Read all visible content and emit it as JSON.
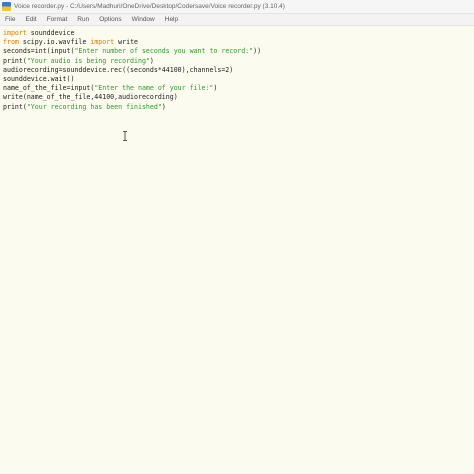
{
  "window": {
    "title": "Voice recorder.py - C:/Users/Madhuri/OneDrive/Desktop/Codersave/Voice recorder.py (3.10.4)",
    "icon": "python-file-icon"
  },
  "menu": {
    "items": [
      "File",
      "Edit",
      "Format",
      "Run",
      "Options",
      "Window",
      "Help"
    ]
  },
  "editor": {
    "lines": [
      [
        {
          "t": "kw",
          "v": "import"
        },
        {
          "t": "plain",
          "v": " sounddevice"
        }
      ],
      [
        {
          "t": "kw",
          "v": "from"
        },
        {
          "t": "plain",
          "v": " scipy.io.wavfile "
        },
        {
          "t": "kw",
          "v": "import"
        },
        {
          "t": "plain",
          "v": " write"
        }
      ],
      [
        {
          "t": "plain",
          "v": "seconds=int(input("
        },
        {
          "t": "str",
          "v": "\"Enter number of seconds you want to record:\""
        },
        {
          "t": "plain",
          "v": "))"
        }
      ],
      [
        {
          "t": "plain",
          "v": "print("
        },
        {
          "t": "str",
          "v": "\"Your audio is being recording\""
        },
        {
          "t": "plain",
          "v": ")"
        }
      ],
      [
        {
          "t": "plain",
          "v": "audiorecording=sounddevice.rec((seconds*44100),channels=2)"
        }
      ],
      [
        {
          "t": "plain",
          "v": "sounddevice.wait()"
        }
      ],
      [
        {
          "t": "plain",
          "v": "name_of_the_file=input("
        },
        {
          "t": "str",
          "v": "\"Enter the name of your file:\""
        },
        {
          "t": "plain",
          "v": ")"
        }
      ],
      [
        {
          "t": "plain",
          "v": "write(name_of_the_file,44100,audiorecording)"
        }
      ],
      [
        {
          "t": "plain",
          "v": "print("
        },
        {
          "t": "str",
          "v": "\"Your recording has been finished\""
        },
        {
          "t": "plain",
          "v": ")"
        }
      ]
    ]
  },
  "colors": {
    "background": "#fbfbf0",
    "keyword": "#e07a00",
    "string": "#2e9a2e",
    "text": "#222222"
  }
}
